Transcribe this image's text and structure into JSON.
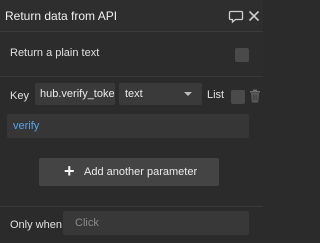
{
  "header": {
    "title": "Return data from API",
    "comment_icon": "speech-bubble-icon",
    "close_icon": "close-icon"
  },
  "plain_text": {
    "label": "Return a plain text",
    "checked": false
  },
  "parameter": {
    "key_label": "Key",
    "key_value": "hub.verify_toker",
    "type_value": "text",
    "list_label": "List",
    "list_checked": false,
    "value": "verify",
    "delete_icon": "trash-icon"
  },
  "add_button": {
    "label": "Add another parameter",
    "icon": "plus-icon"
  },
  "only_when": {
    "label": "Only when",
    "placeholder": "Click"
  },
  "colors": {
    "background": "#2b2b2b",
    "link_blue": "#5aa2e8",
    "button": "#444444"
  }
}
